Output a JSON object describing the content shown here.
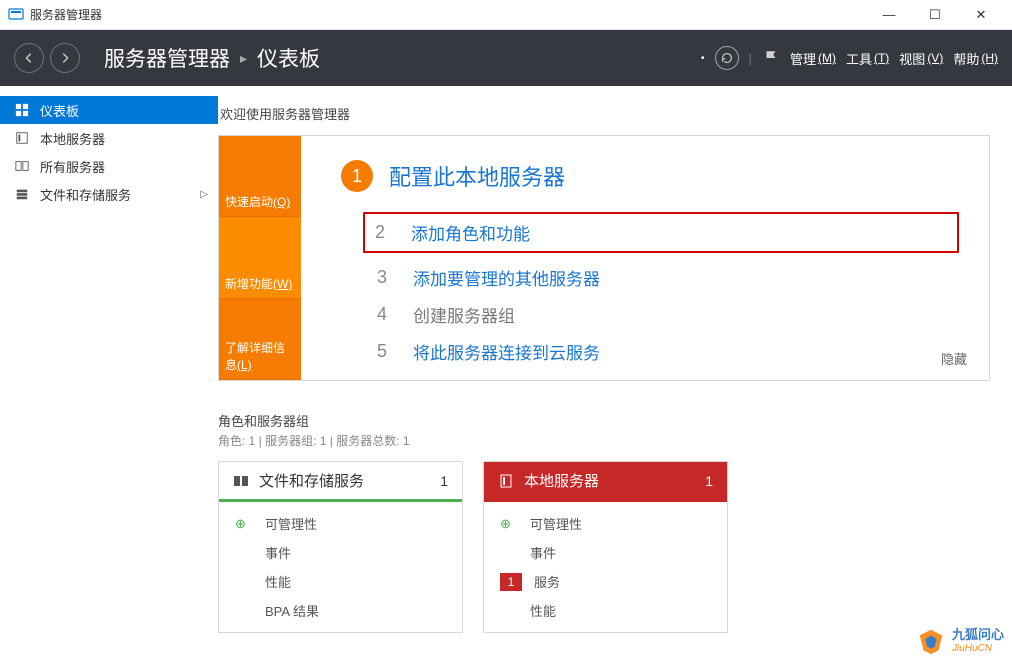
{
  "window": {
    "title": "服务器管理器"
  },
  "header": {
    "breadcrumb": [
      "服务器管理器",
      "仪表板"
    ],
    "menus": [
      {
        "label": "管理",
        "hotkey": "(M)"
      },
      {
        "label": "工具",
        "hotkey": "(T)"
      },
      {
        "label": "视图",
        "hotkey": "(V)"
      },
      {
        "label": "帮助",
        "hotkey": "(H)"
      }
    ]
  },
  "sidebar": {
    "items": [
      {
        "label": "仪表板",
        "icon": "dashboard",
        "active": true
      },
      {
        "label": "本地服务器",
        "icon": "server"
      },
      {
        "label": "所有服务器",
        "icon": "servers"
      },
      {
        "label": "文件和存储服务",
        "icon": "storage",
        "expandable": true
      }
    ]
  },
  "content": {
    "welcome_title": "欢迎使用服务器管理器",
    "quickstart": {
      "left_sections": [
        {
          "label": "快速启动",
          "hotkey": "(Q)"
        },
        {
          "label": "新增功能",
          "hotkey": "(W)"
        },
        {
          "label": "了解详细信息",
          "hotkey": "(L)"
        }
      ],
      "heading_num": "1",
      "heading": "配置此本地服务器",
      "steps": [
        {
          "num": "2",
          "label": "添加角色和功能",
          "highlight": true
        },
        {
          "num": "3",
          "label": "添加要管理的其他服务器"
        },
        {
          "num": "4",
          "label": "创建服务器组",
          "grey": true
        },
        {
          "num": "5",
          "label": "将此服务器连接到云服务",
          "grey": false
        }
      ],
      "hide_label": "隐藏"
    },
    "roles": {
      "title": "角色和服务器组",
      "subtitle": "角色: 1 | 服务器组: 1 | 服务器总数: 1",
      "cards": [
        {
          "style": "green",
          "title": "文件和存储服务",
          "count": "1",
          "rows": [
            {
              "icon": "up",
              "label": "可管理性"
            },
            {
              "icon": "",
              "label": "事件"
            },
            {
              "icon": "",
              "label": "性能"
            },
            {
              "icon": "",
              "label": "BPA 结果"
            }
          ]
        },
        {
          "style": "red",
          "title": "本地服务器",
          "count": "1",
          "rows": [
            {
              "icon": "up",
              "label": "可管理性"
            },
            {
              "icon": "",
              "label": "事件"
            },
            {
              "icon": "badge",
              "badge": "1",
              "label": "服务"
            },
            {
              "icon": "",
              "label": "性能"
            }
          ]
        }
      ]
    }
  },
  "watermark": {
    "cn": "九狐问心",
    "en": "JiuHuCN"
  }
}
